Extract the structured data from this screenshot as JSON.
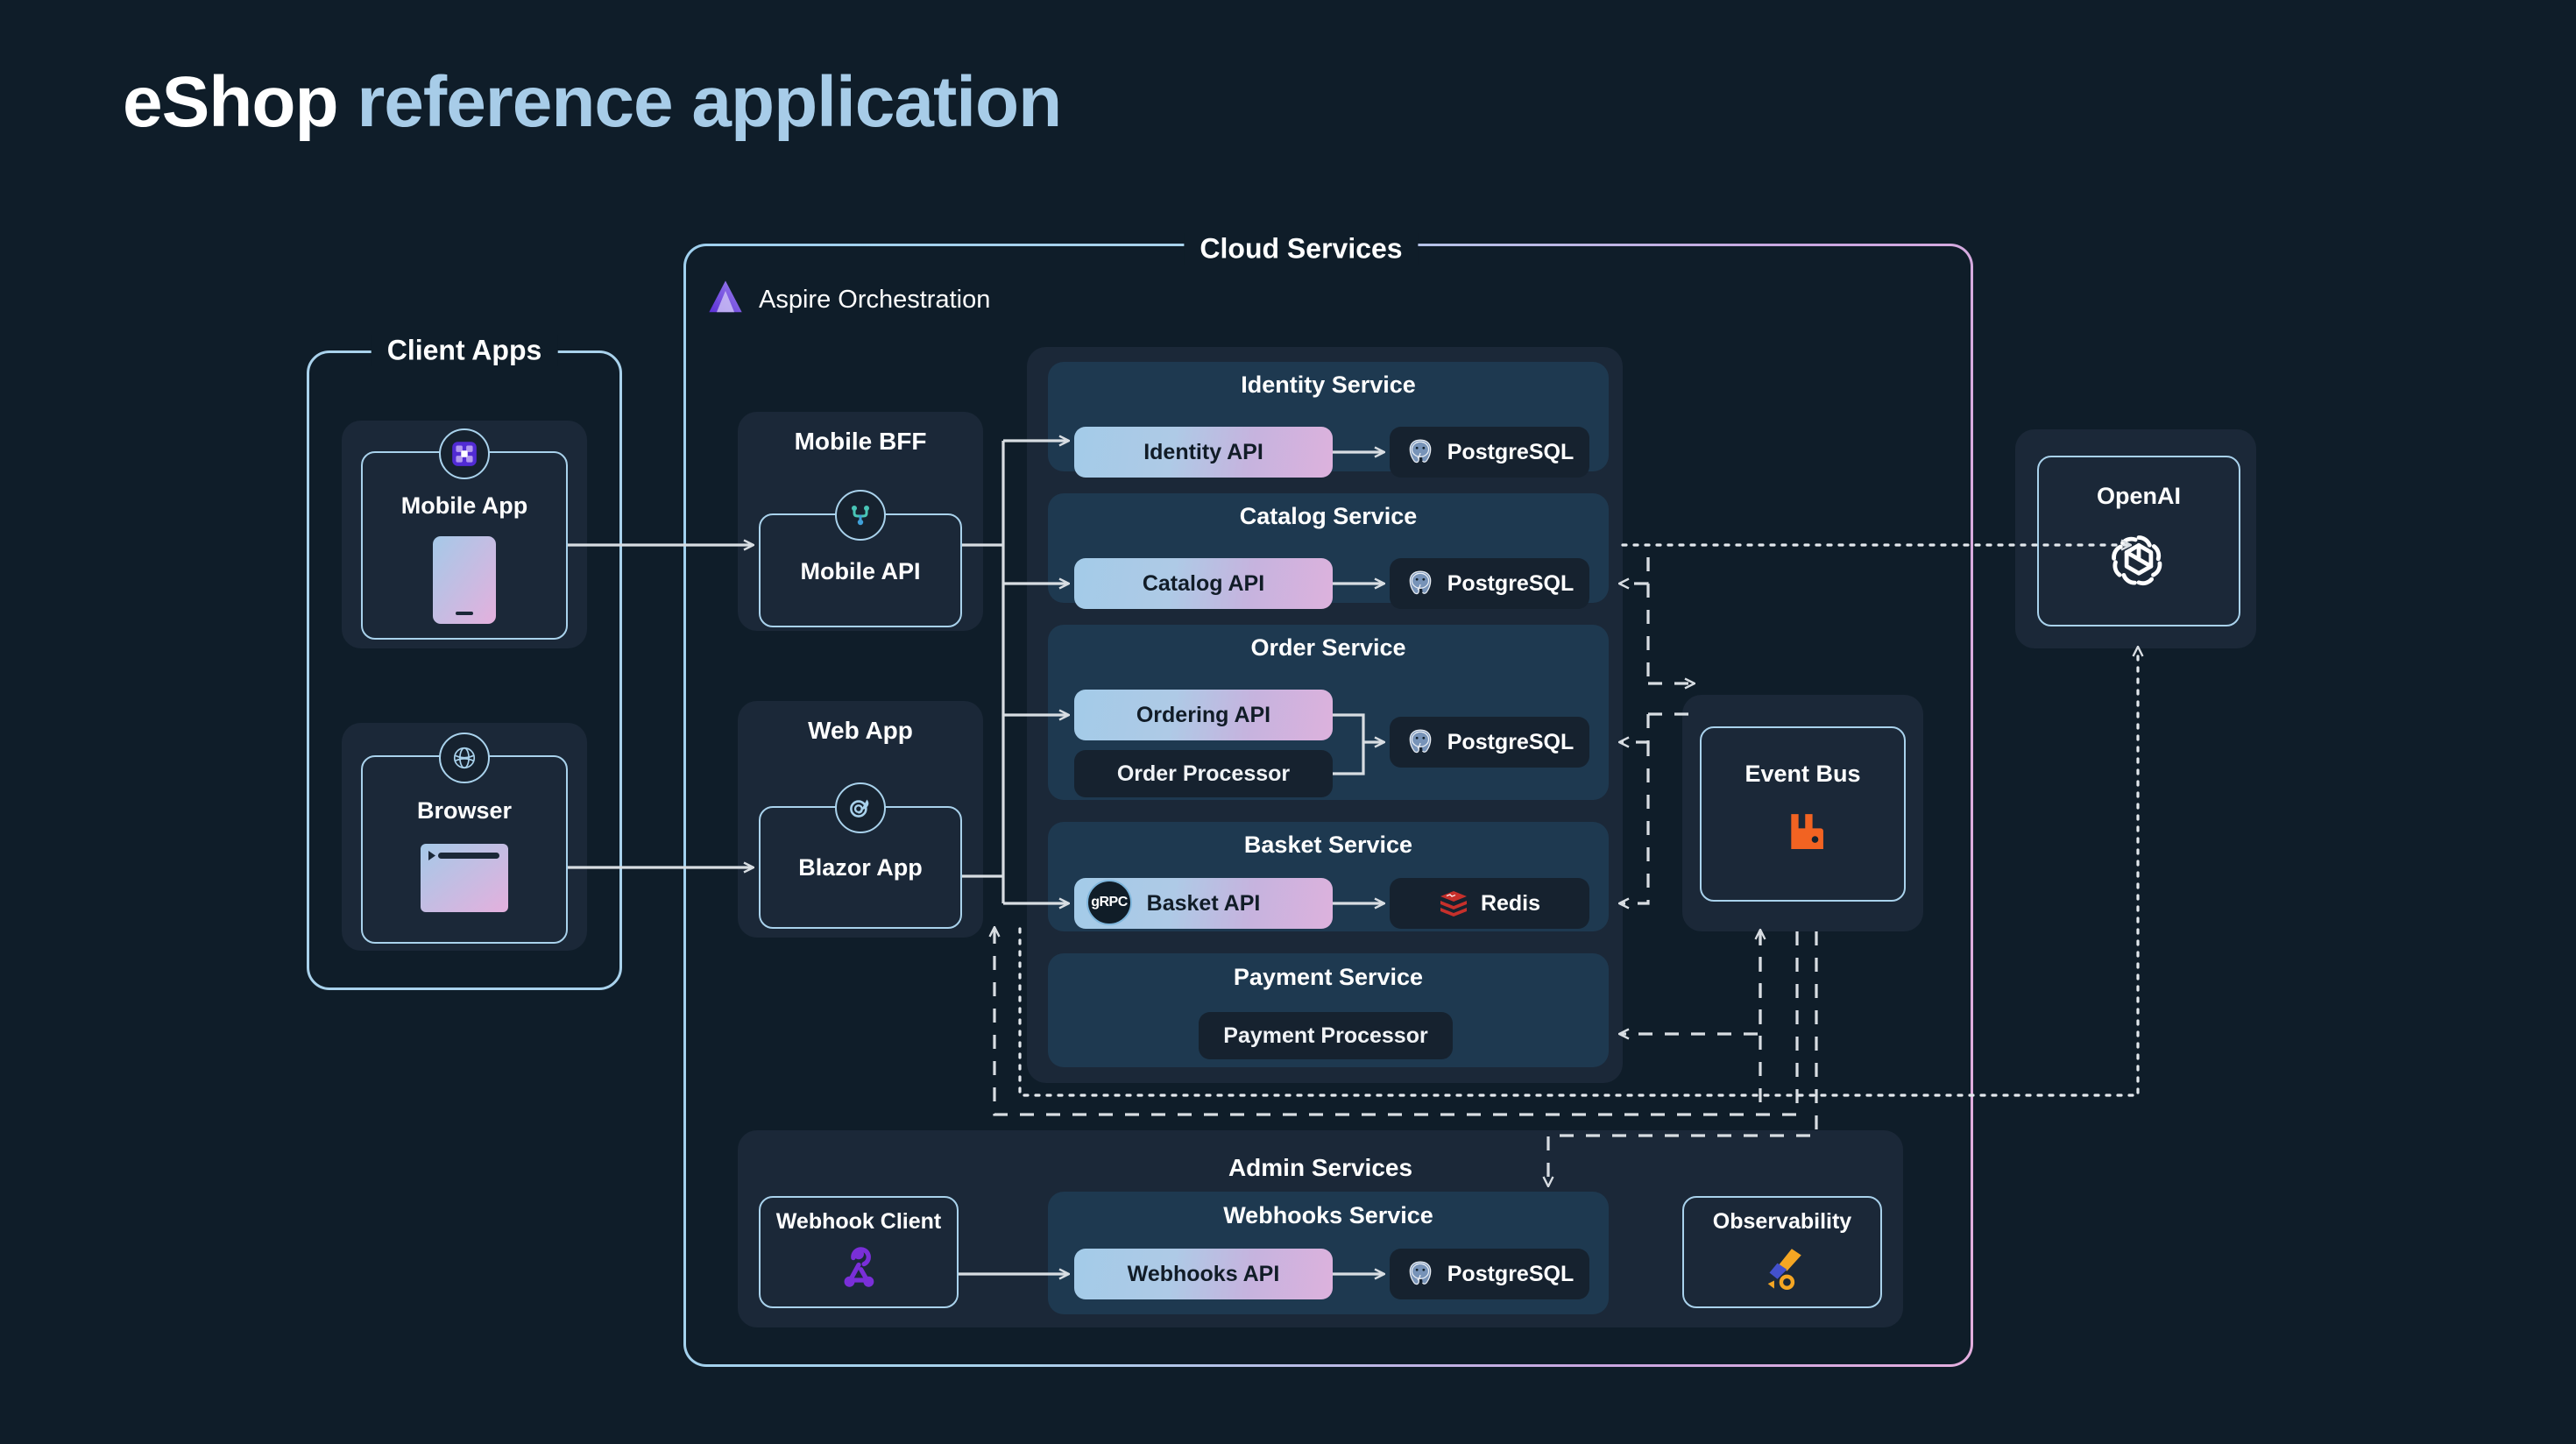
{
  "title": {
    "part1": "eShop",
    "part2": "reference application"
  },
  "groups": {
    "client_apps": {
      "label": "Client Apps"
    },
    "cloud_services": {
      "label": "Cloud Services"
    }
  },
  "orchestration": {
    "label": "Aspire Orchestration",
    "icon": "aspire-triangle-icon"
  },
  "client_apps": [
    {
      "panel_title": "",
      "node_label": "Mobile App",
      "badge_icon": "dotnet-maui-icon",
      "art": "phone-illustration"
    },
    {
      "panel_title": "",
      "node_label": "Browser",
      "badge_icon": "blazor-globe-icon",
      "art": "browser-window-illustration"
    }
  ],
  "bff": [
    {
      "panel_title": "Mobile BFF",
      "node_label": "Mobile API",
      "badge_icon": "yarp-icon"
    },
    {
      "panel_title": "Web App",
      "node_label": "Blazor App",
      "badge_icon": "blazor-flame-icon"
    }
  ],
  "services": [
    {
      "title": "Identity Service",
      "api": {
        "label": "Identity API",
        "grpc": false
      },
      "store": {
        "label": "PostgreSQL",
        "icon": "postgresql-elephant-icon"
      },
      "extra": null
    },
    {
      "title": "Catalog Service",
      "api": {
        "label": "Catalog API",
        "grpc": false
      },
      "store": {
        "label": "PostgreSQL",
        "icon": "postgresql-elephant-icon"
      },
      "extra": null
    },
    {
      "title": "Order Service",
      "api": {
        "label": "Ordering API",
        "grpc": false
      },
      "store": {
        "label": "PostgreSQL",
        "icon": "postgresql-elephant-icon"
      },
      "extra": {
        "label": "Order Processor"
      }
    },
    {
      "title": "Basket Service",
      "api": {
        "label": "Basket API",
        "grpc": true,
        "grpc_label": "gRPC"
      },
      "store": {
        "label": "Redis",
        "icon": "redis-stack-icon"
      },
      "extra": null
    },
    {
      "title": "Payment Service",
      "api": null,
      "store": null,
      "extra": {
        "label": "Payment Processor"
      }
    }
  ],
  "event_bus": {
    "label": "Event Bus",
    "icon": "rabbitmq-icon"
  },
  "openai": {
    "label": "OpenAI",
    "icon": "openai-logo-icon"
  },
  "admin": {
    "title": "Admin Services",
    "webhook_client": {
      "label": "Webhook Client",
      "icon": "webhook-icon"
    },
    "webhooks_service": {
      "title": "Webhooks Service",
      "api": {
        "label": "Webhooks API"
      },
      "store": {
        "label": "PostgreSQL",
        "icon": "postgresql-elephant-icon"
      }
    },
    "observability": {
      "label": "Observability",
      "icon": "opentelemetry-icon"
    }
  },
  "colors": {
    "background": "#0f1d29",
    "accent_blue": "#a9d2ec",
    "accent_pink": "#e3aede",
    "panel": "#1b2838",
    "service_panel": "#1e3950",
    "rabbitmq_orange": "#f26322",
    "postgres_blue": "#7793b8",
    "redis_red": "#c6302b",
    "webhook_purple": "#7a2fd8",
    "title_blue": "#a7cce8"
  }
}
